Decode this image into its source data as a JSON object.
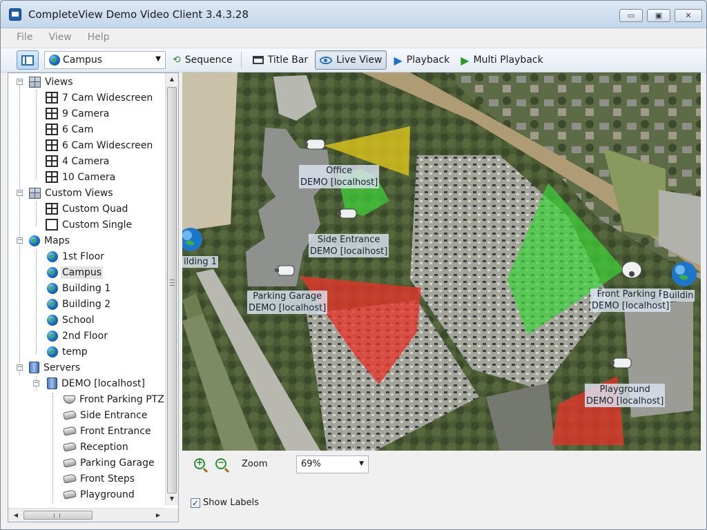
{
  "window": {
    "title": "CompleteView Demo Video Client 3.4.3.28",
    "controls": {
      "minimize": "▭",
      "maximize": "▣",
      "close": "✕"
    }
  },
  "menu": [
    "File",
    "View",
    "Help"
  ],
  "toolbar": {
    "map_select": "Campus",
    "sequence": "Sequence",
    "title_bar": "Title Bar",
    "live_view": "Live View",
    "playback": "Playback",
    "multi_playback": "Multi Playback"
  },
  "tree": {
    "views": {
      "label": "Views",
      "items": [
        "7 Cam Widescreen",
        "9 Camera",
        "6 Cam",
        "6 Cam Widescreen",
        "4 Camera",
        "10 Camera"
      ]
    },
    "custom_views": {
      "label": "Custom Views",
      "items": [
        "Custom Quad",
        "Custom Single"
      ]
    },
    "maps": {
      "label": "Maps",
      "items": [
        "1st Floor",
        "Campus",
        "Building 1",
        "Building 2",
        "School",
        "2nd Floor",
        "temp"
      ],
      "selected": "Campus"
    },
    "servers": {
      "label": "Servers",
      "server": "DEMO [localhost]",
      "cameras": [
        "Front Parking PTZ",
        "Side Entrance",
        "Front Entrance",
        "Reception",
        "Parking Garage",
        "Front Steps",
        "Playground"
      ]
    }
  },
  "map": {
    "labels": {
      "office": [
        "Office",
        "DEMO [localhost]"
      ],
      "side_entrance": [
        "Side Entrance",
        "DEMO [localhost]"
      ],
      "parking_garage": [
        "Parking Garage",
        "DEMO [localhost]"
      ],
      "front_parking": [
        "Front Parking P",
        "DEMO [localhost]"
      ],
      "playground": [
        "Playground",
        "DEMO [localhost]"
      ],
      "building_left": "ilding 1",
      "building_right": "Buildin"
    },
    "colors": {
      "yellow": "#d9c21c",
      "green": "#3fd33a",
      "red": "#e5352a"
    }
  },
  "bottom": {
    "zoom_label": "Zoom",
    "zoom_value": "69%",
    "show_labels": "Show Labels",
    "show_labels_checked": true
  }
}
